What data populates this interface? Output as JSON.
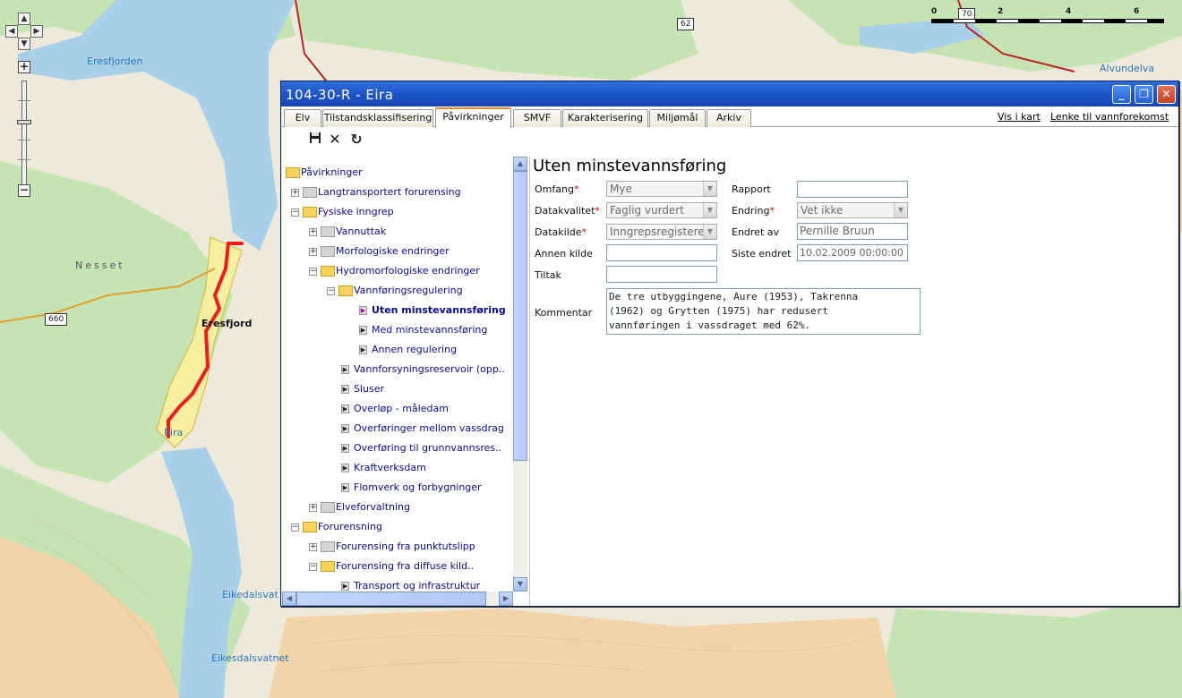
{
  "map": {
    "place_labels": [
      {
        "text": "Eresfjorden"
      },
      {
        "text": "Nesset"
      },
      {
        "text": "Eresfjord"
      },
      {
        "text": "Eira"
      },
      {
        "text": "Eikedalsvat"
      },
      {
        "text": "Eikesdalsvatnet"
      },
      {
        "text": "Alvundelva"
      }
    ],
    "road_shields": [
      "62",
      "660",
      "70"
    ],
    "scale": {
      "ticks": [
        "0",
        "2",
        "4",
        "6"
      ]
    },
    "colors": {
      "water": "#a9cfe9",
      "land": "#eeeadb",
      "forest": "#c6e3b4",
      "river_highlight": "#ee1c1c"
    }
  },
  "nav": {
    "pan_up": "▲",
    "pan_down": "▼",
    "pan_left": "◀",
    "pan_right": "▶",
    "zoom_in": "+",
    "zoom_out": "−"
  },
  "dialog": {
    "title": "104-30-R - Eira",
    "window_buttons": {
      "minimize": "_",
      "restore": "❐",
      "close": "✕"
    },
    "tabs": [
      "Elv",
      "Tilstandsklassifisering",
      "Påvirkninger",
      "SMVF",
      "Karakterisering",
      "Miljømål",
      "Arkiv"
    ],
    "active_tab": "Påvirkninger",
    "links": {
      "show_map": "Vis i kart",
      "link": "Lenke til vannforekomst"
    },
    "toolbar": {
      "save_icon": "floppy-disk",
      "delete_icon": "x-mark",
      "refresh_icon": "refresh-arrow"
    }
  },
  "tree": {
    "nodes": [
      {
        "label": "Påvirkninger",
        "level": 0,
        "type": "folder-open",
        "expander": ""
      },
      {
        "label": "Langtransportert forurensing",
        "level": 1,
        "type": "folder-grey",
        "expander": "+"
      },
      {
        "label": "Fysiske inngrep",
        "level": 1,
        "type": "folder-open",
        "expander": "−"
      },
      {
        "label": "Vannuttak",
        "level": 2,
        "type": "folder-grey",
        "expander": "+"
      },
      {
        "label": "Morfologiske endringer",
        "level": 2,
        "type": "folder-grey",
        "expander": "+"
      },
      {
        "label": "Hydromorfologiske endringer",
        "level": 2,
        "type": "folder-open",
        "expander": "−"
      },
      {
        "label": "Vannføringsregulering",
        "level": 3,
        "type": "folder-open",
        "expander": "−"
      },
      {
        "label": "Uten minstevannsføring",
        "level": 4,
        "type": "leaf-selected",
        "expander": ""
      },
      {
        "label": "Med minstevannsføring",
        "level": 4,
        "type": "leaf",
        "expander": ""
      },
      {
        "label": "Annen regulering",
        "level": 4,
        "type": "leaf",
        "expander": ""
      },
      {
        "label": "Vannforsyningsreservoir (opp..",
        "level": 3,
        "type": "leaf",
        "expander": ""
      },
      {
        "label": "Sluser",
        "level": 3,
        "type": "leaf",
        "expander": ""
      },
      {
        "label": "Overløp - måledam",
        "level": 3,
        "type": "leaf",
        "expander": ""
      },
      {
        "label": "Overføringer mellom vassdrag",
        "level": 3,
        "type": "leaf",
        "expander": ""
      },
      {
        "label": "Overføring til grunnvannsres..",
        "level": 3,
        "type": "leaf",
        "expander": ""
      },
      {
        "label": "Kraftverksdam",
        "level": 3,
        "type": "leaf",
        "expander": ""
      },
      {
        "label": "Flomverk og forbygninger",
        "level": 3,
        "type": "leaf",
        "expander": ""
      },
      {
        "label": "Elveforvaltning",
        "level": 2,
        "type": "folder-grey",
        "expander": "+"
      },
      {
        "label": "Forurensning",
        "level": 1,
        "type": "folder-open",
        "expander": "−"
      },
      {
        "label": "Forurensing fra punktutslipp",
        "level": 2,
        "type": "folder-grey",
        "expander": "+"
      },
      {
        "label": "Forurensing fra diffuse kild..",
        "level": 2,
        "type": "folder-open",
        "expander": "−"
      },
      {
        "label": "Transport og infrastruktur",
        "level": 3,
        "type": "leaf",
        "expander": ""
      }
    ]
  },
  "form": {
    "heading": "Uten minstevannsføring",
    "omfang": {
      "label": "Omfang",
      "value": "Mye"
    },
    "datakvalitet": {
      "label": "Datakvalitet",
      "value": "Faglig vurdert"
    },
    "datakilde": {
      "label": "Datakilde",
      "value": "Inngrepsregistere"
    },
    "annen_kilde": {
      "label": "Annen kilde",
      "value": ""
    },
    "tiltak": {
      "label": "Tiltak",
      "value": ""
    },
    "kommentar": {
      "label": "Kommentar",
      "value": "De tre utbyggingene, Aure (1953), Takrenna\n(1962) og Grytten (1975) har redusert\nvannføringen i vassdraget med 62%."
    },
    "rapport": {
      "label": "Rapport",
      "value": ""
    },
    "endring": {
      "label": "Endring",
      "value": "Vet ikke"
    },
    "endret_av": {
      "label": "Endret av",
      "value": "Pernille Bruun"
    },
    "siste_endret": {
      "label": "Siste endret",
      "value": "10.02.2009 00:00:00"
    },
    "required_marker": "*"
  }
}
